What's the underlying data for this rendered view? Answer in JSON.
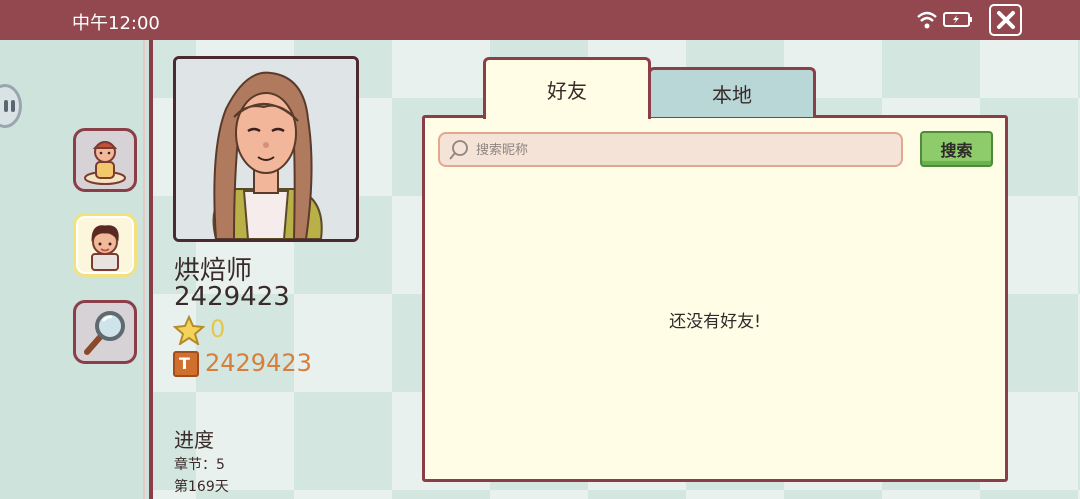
{
  "status_bar": {
    "time": "中午12:00"
  },
  "profile": {
    "name": "烘焙师",
    "id": "2429423",
    "stars": "0",
    "coins": "2429423"
  },
  "progress": {
    "title": "进度",
    "chapter": "章节：5",
    "day": "第169天"
  },
  "tabs": [
    {
      "label": "好友",
      "active": true
    },
    {
      "label": "本地",
      "active": false
    }
  ],
  "search": {
    "placeholder": "搜索昵称",
    "value": "",
    "button_label": "搜索"
  },
  "empty_message": "还没有好友!",
  "colors": {
    "status_bar": "#934850",
    "border": "#8a3e48",
    "panel_bg": "#fffde6",
    "tab_inactive": "#b8d7d6",
    "search_button": "#8ecb6a",
    "star": "#e7c64c",
    "coins": "#d67f3d"
  },
  "icons": [
    "wifi-icon",
    "battery-icon",
    "close-icon",
    "chef-avatar-icon",
    "friends-avatar-icon",
    "magnifier-icon",
    "star-icon",
    "coin-icon",
    "search-icon"
  ]
}
